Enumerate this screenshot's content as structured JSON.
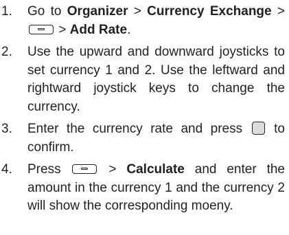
{
  "steps": [
    {
      "number": "1.",
      "part1": "Go to ",
      "organizer": "Organizer",
      "sep1": " > ",
      "currency_exchange": "Currency Exchange",
      "sep2": " > ",
      "sep3": " > ",
      "add_rate": "Add Rate",
      "end": ".",
      "key_icon": "menu-key-icon"
    },
    {
      "number": "2.",
      "text": "Use the upward and downward joysticks to set currency 1 and 2. Use the leftward and rightward joystick keys to change the currency."
    },
    {
      "number": "3.",
      "part1": "Enter the currency rate and press ",
      "part2": " to confirm.",
      "key_icon": "ok-key-icon"
    },
    {
      "number": "4.",
      "part1": "Press ",
      "sep": " > ",
      "calculate": "Calculate",
      "part2": " and enter the amount in the currency 1 and the currency 2 will show the corresponding moeny.",
      "key_icon": "menu-key-icon"
    }
  ]
}
